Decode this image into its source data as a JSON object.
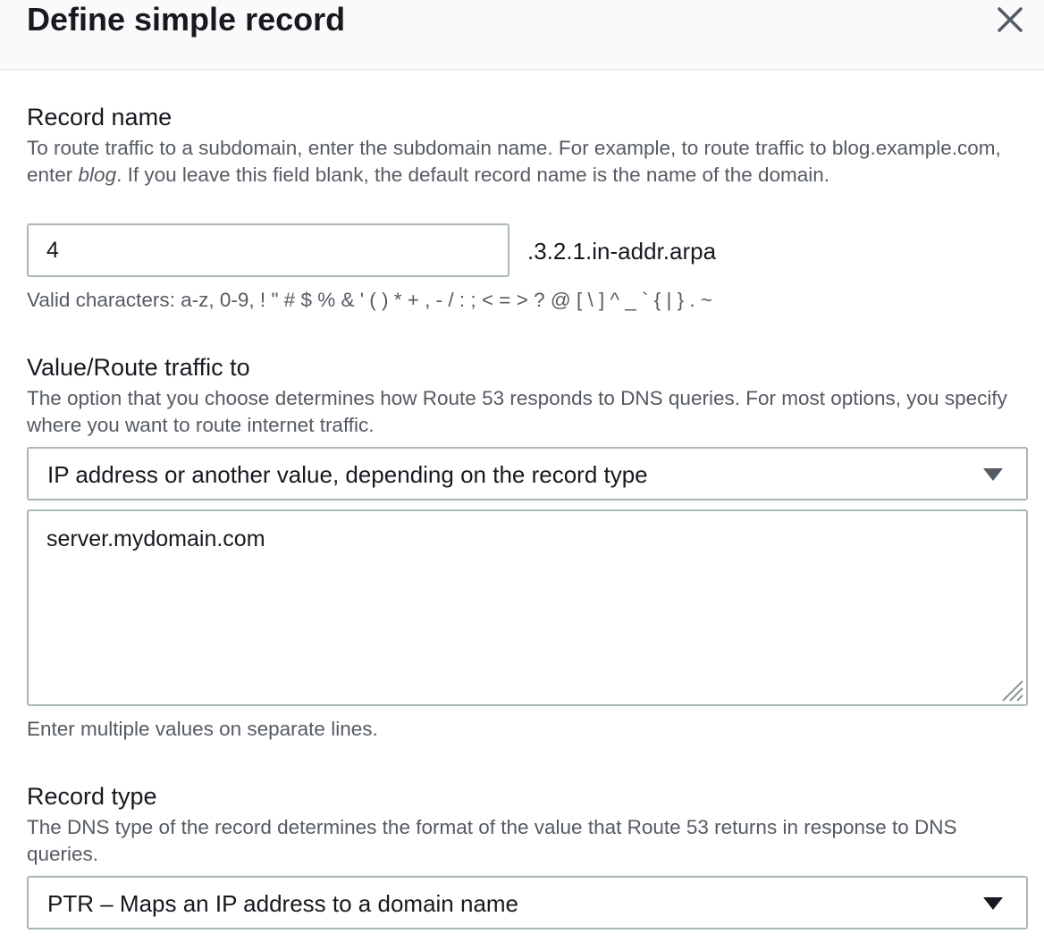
{
  "dialog": {
    "title": "Define simple record",
    "close_icon": "close-icon"
  },
  "record_name": {
    "label": "Record name",
    "description_part1": "To route traffic to a subdomain, enter the subdomain name. For example, to route traffic to blog.example.com, enter ",
    "description_em": "blog",
    "description_part2": ". If you leave this field blank, the default record name is the name of the domain.",
    "value": "4",
    "suffix": ".3.2.1.in-addr.arpa",
    "hint": "Valid characters: a-z, 0-9, ! \" # $ % & ' ( ) * + , - / : ; < = > ? @ [ \\ ] ^ _ ` { | } . ~"
  },
  "value_route": {
    "label": "Value/Route traffic to",
    "description": "The option that you choose determines how Route 53 responds to DNS queries. For most options, you specify where you want to route internet traffic.",
    "selected": "IP address or another value, depending on the record type",
    "textarea_value": "server.mydomain.com",
    "hint": "Enter multiple values on separate lines."
  },
  "record_type": {
    "label": "Record type",
    "description": "The DNS type of the record determines the format of the value that Route 53 returns in response to DNS queries.",
    "selected": "PTR – Maps an IP address to a domain name"
  },
  "icons": {
    "dropdown": "caret-down-icon",
    "resize": "resize-grip-icon"
  },
  "colors": {
    "text": "#16191f",
    "secondary_text": "#545b64",
    "border": "#aab7b8",
    "header_bg": "#fafafa"
  }
}
